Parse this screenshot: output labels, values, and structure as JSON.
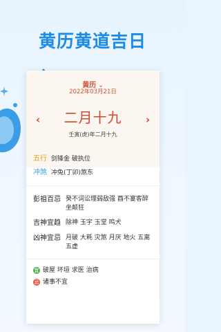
{
  "headline": "黄历黄道吉日",
  "selector": {
    "label": "黄历",
    "chevron_icon": "chevron-down-icon"
  },
  "date": "2022年03月21日",
  "lunar_date": "二月十九",
  "nav": {
    "prev_icon": "chevron-left-icon",
    "next_icon": "chevron-right-icon"
  },
  "ganzhi": "壬寅(虎)年二月十九",
  "wuxing": {
    "label": "五行",
    "value": "剑锋金 破执位"
  },
  "chongsha": {
    "label": "冲煞",
    "value": "冲兔(丁卯)煞东"
  },
  "pengzu": {
    "label": "彭祖百忌",
    "value": "癸不词讼理弱敌强 酉不宴客醉坐颠狂"
  },
  "jishen": {
    "label": "吉神宜趋",
    "value": "除神 玉宇 玉堂 鸣犬"
  },
  "xiongshen": {
    "label": "凶神宜忌",
    "value": "月破 大耗 灾煞 月厌 地火 五离 五虚"
  },
  "yi": {
    "badge": "宜",
    "value": "破屋 坏垣 求医 治病"
  },
  "ji": {
    "badge": "忌",
    "value": "诸事不宜"
  },
  "colors": {
    "accent_blue": "#1b8be6",
    "lunar_red": "#d2472f",
    "wuxing_orange": "#e0a31a",
    "chongsha_blue": "#3aa0dc",
    "yi_green": "#4caf50",
    "ji_red": "#e0533a"
  }
}
